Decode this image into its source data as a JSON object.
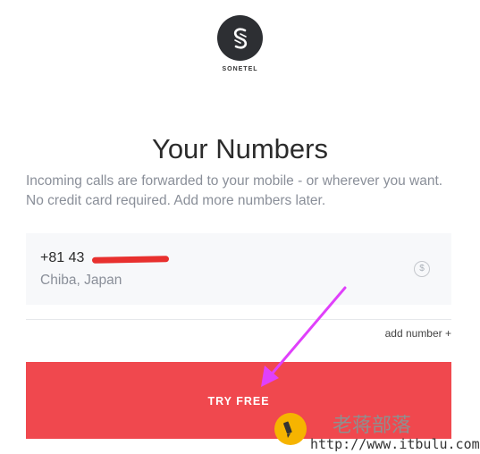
{
  "brand": {
    "name": "SONETEL",
    "logo_icon": "sonetel-s-icon"
  },
  "page": {
    "title": "Your Numbers",
    "intro": "Incoming calls are forwarded to your mobile - or wherever you want. No credit card required. Add more numbers later."
  },
  "number_card": {
    "number_prefix": "+81 43",
    "location": "Chiba, Japan",
    "price_icon": "dollar-circle-icon"
  },
  "actions": {
    "add_number_label": "add number +",
    "try_free_label": "TRY FREE"
  },
  "colors": {
    "accent": "#f0484e",
    "logo_bg": "#2d2f33",
    "annotation_arrow": "#e040fb"
  },
  "watermark": {
    "text": "老蒋部落",
    "url": "http://www.itbulu.com"
  }
}
